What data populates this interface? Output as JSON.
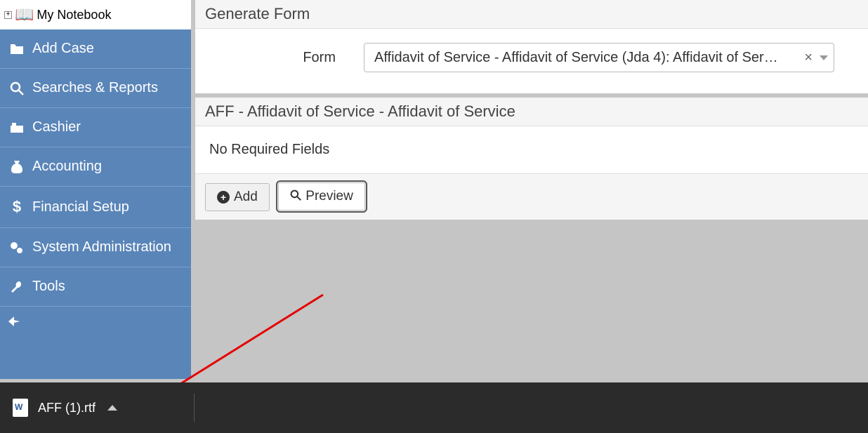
{
  "sidebar": {
    "notebook_label": "My Notebook",
    "items": [
      {
        "label": "Add Case"
      },
      {
        "label": "Searches & Reports"
      },
      {
        "label": "Cashier"
      },
      {
        "label": "Accounting"
      },
      {
        "label": "Financial Setup"
      },
      {
        "label": "System Administration"
      },
      {
        "label": "Tools"
      }
    ]
  },
  "main": {
    "generate_form_title": "Generate Form",
    "form_label": "Form",
    "form_value": "Affidavit of Service - Affidavit of Service (Jda 4): Affidavit of Ser…",
    "section_title": "AFF - Affidavit of Service - Affidavit of Service",
    "no_fields_text": "No Required Fields",
    "add_button": "Add",
    "preview_button": "Preview"
  },
  "download": {
    "filename": "AFF (1).rtf"
  }
}
